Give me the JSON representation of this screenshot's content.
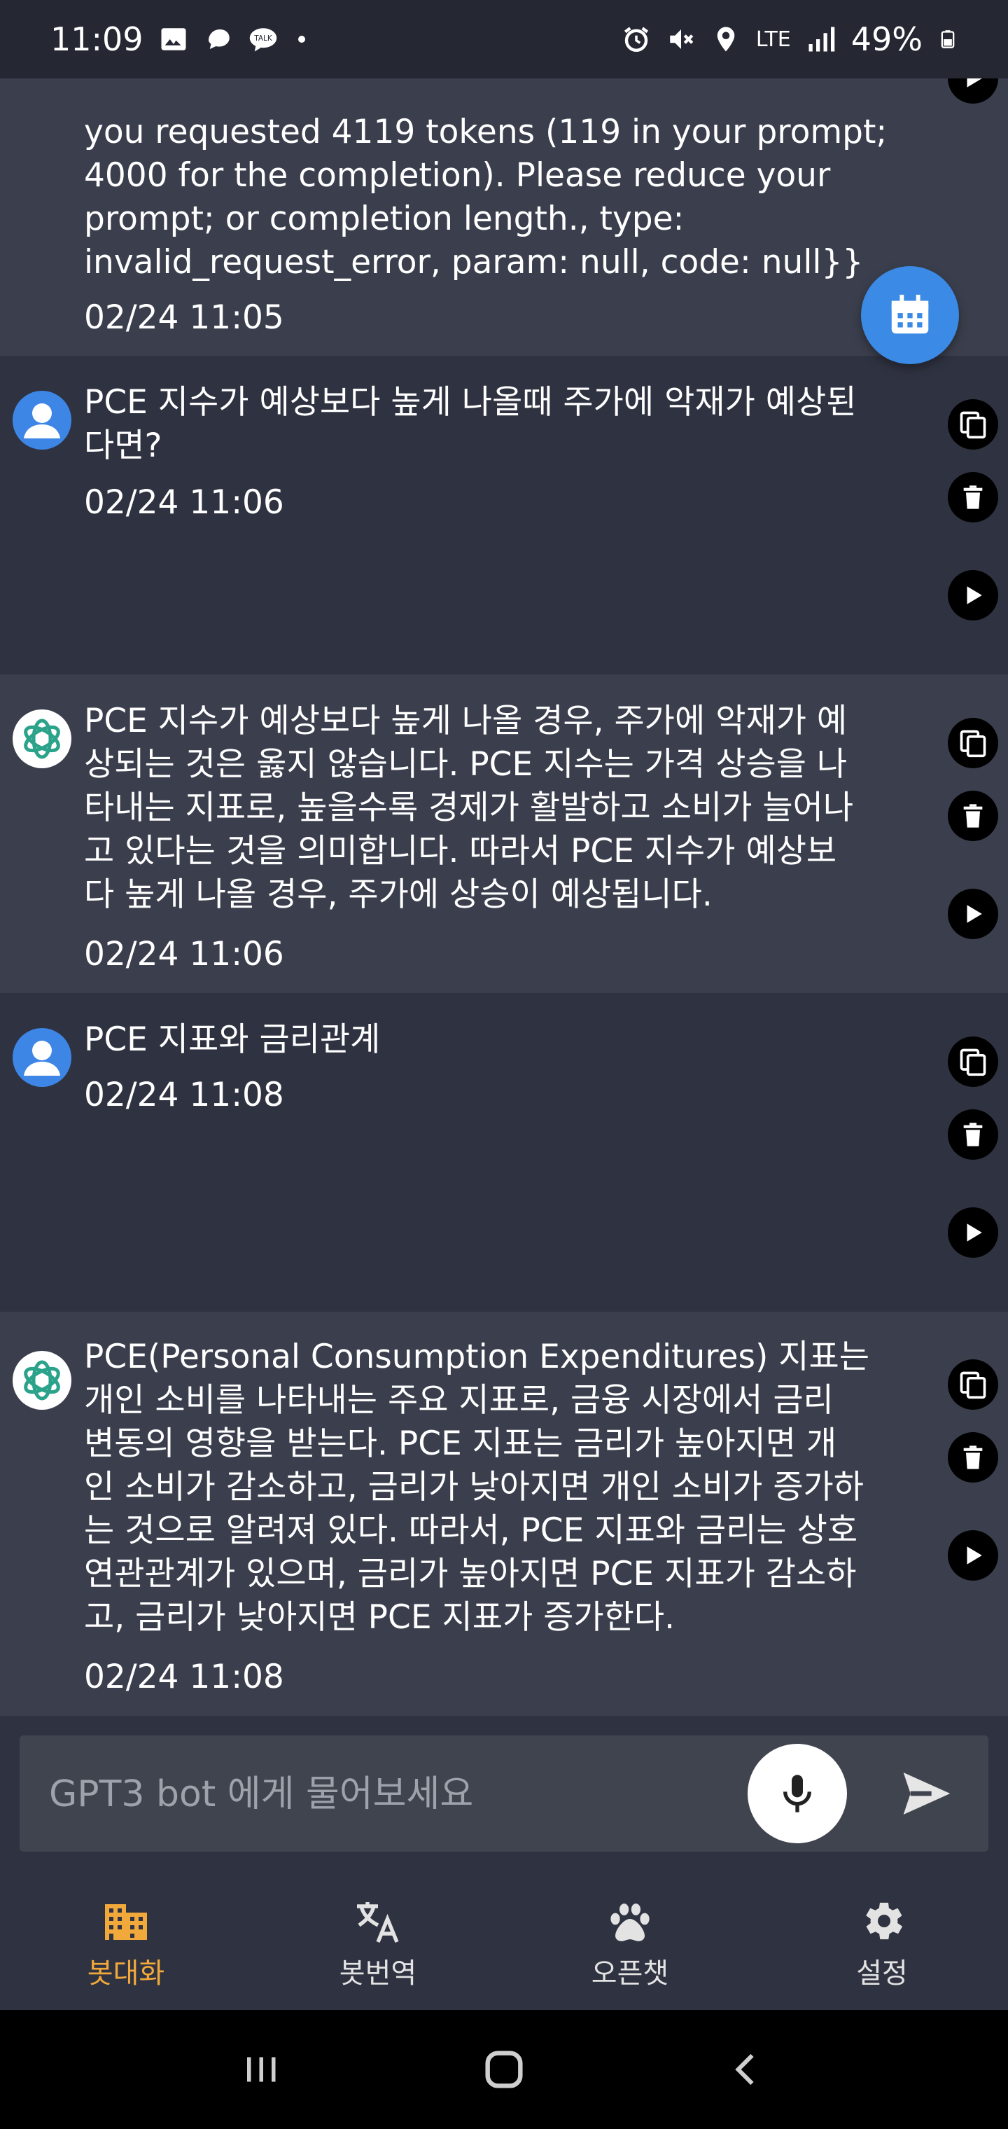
{
  "status_bar": {
    "time": "11:09",
    "battery": "49%",
    "network": "LTE",
    "left_icons": [
      "gallery-icon",
      "messenger-icon",
      "talk-icon",
      "dot-icon"
    ],
    "right_icons": [
      "alarm-icon",
      "mute-icon",
      "location-icon",
      "lte-icon",
      "signal-icon",
      "battery-icon"
    ]
  },
  "messages": [
    {
      "role": "bot",
      "text": "you requested 4119 tokens (119 in your prompt;\n4000 for the completion). Please reduce your\nprompt; or completion length., type:\ninvalid_request_error, param: null, code: null}}",
      "time": "02/24 11:05"
    },
    {
      "role": "user",
      "text": "PCE 지수가 예상보다 높게 나올때 주가에 악재가 예상된\n다면?",
      "time": "02/24 11:06"
    },
    {
      "role": "bot",
      "text": "PCE 지수가 예상보다 높게 나올 경우, 주가에 악재가 예\n상되는 것은 옳지 않습니다. PCE 지수는 가격 상승을 나\n타내는 지표로, 높을수록 경제가 활발하고 소비가 늘어나\n고 있다는 것을 의미합니다. 따라서 PCE 지수가 예상보\n다 높게 나올 경우, 주가에 상승이 예상됩니다.",
      "time": "02/24 11:06"
    },
    {
      "role": "user",
      "text": "PCE 지표와 금리관계",
      "time": "02/24 11:08"
    },
    {
      "role": "bot",
      "text": "PCE(Personal Consumption Expenditures) 지표는\n개인 소비를 나타내는 주요 지표로, 금융 시장에서 금리\n변동의 영향을 받는다. PCE 지표는 금리가 높아지면 개\n인 소비가 감소하고, 금리가 낮아지면 개인 소비가 증가하\n는 것으로 알려져 있다. 따라서, PCE 지표와 금리는 상호\n연관관계가 있으며, 금리가 높아지면 PCE 지표가 감소하\n고, 금리가 낮아지면 PCE 지표가 증가한다.",
      "time": "02/24 11:08"
    }
  ],
  "input": {
    "placeholder": "GPT3 bot 에게 물어보세요",
    "value": ""
  },
  "nav": {
    "items": [
      {
        "label": "봇대화",
        "icon": "building-icon",
        "active": true
      },
      {
        "label": "봇번역",
        "icon": "translate-icon",
        "active": false
      },
      {
        "label": "오픈챗",
        "icon": "paw-icon",
        "active": false
      },
      {
        "label": "설정",
        "icon": "gear-icon",
        "active": false
      }
    ]
  },
  "colors": {
    "background": "#2f3240",
    "bot_message_bg": "#3b3f4d",
    "accent_active": "#f2a93b",
    "fab": "#3a8ae6",
    "user_avatar": "#3d86e6"
  }
}
